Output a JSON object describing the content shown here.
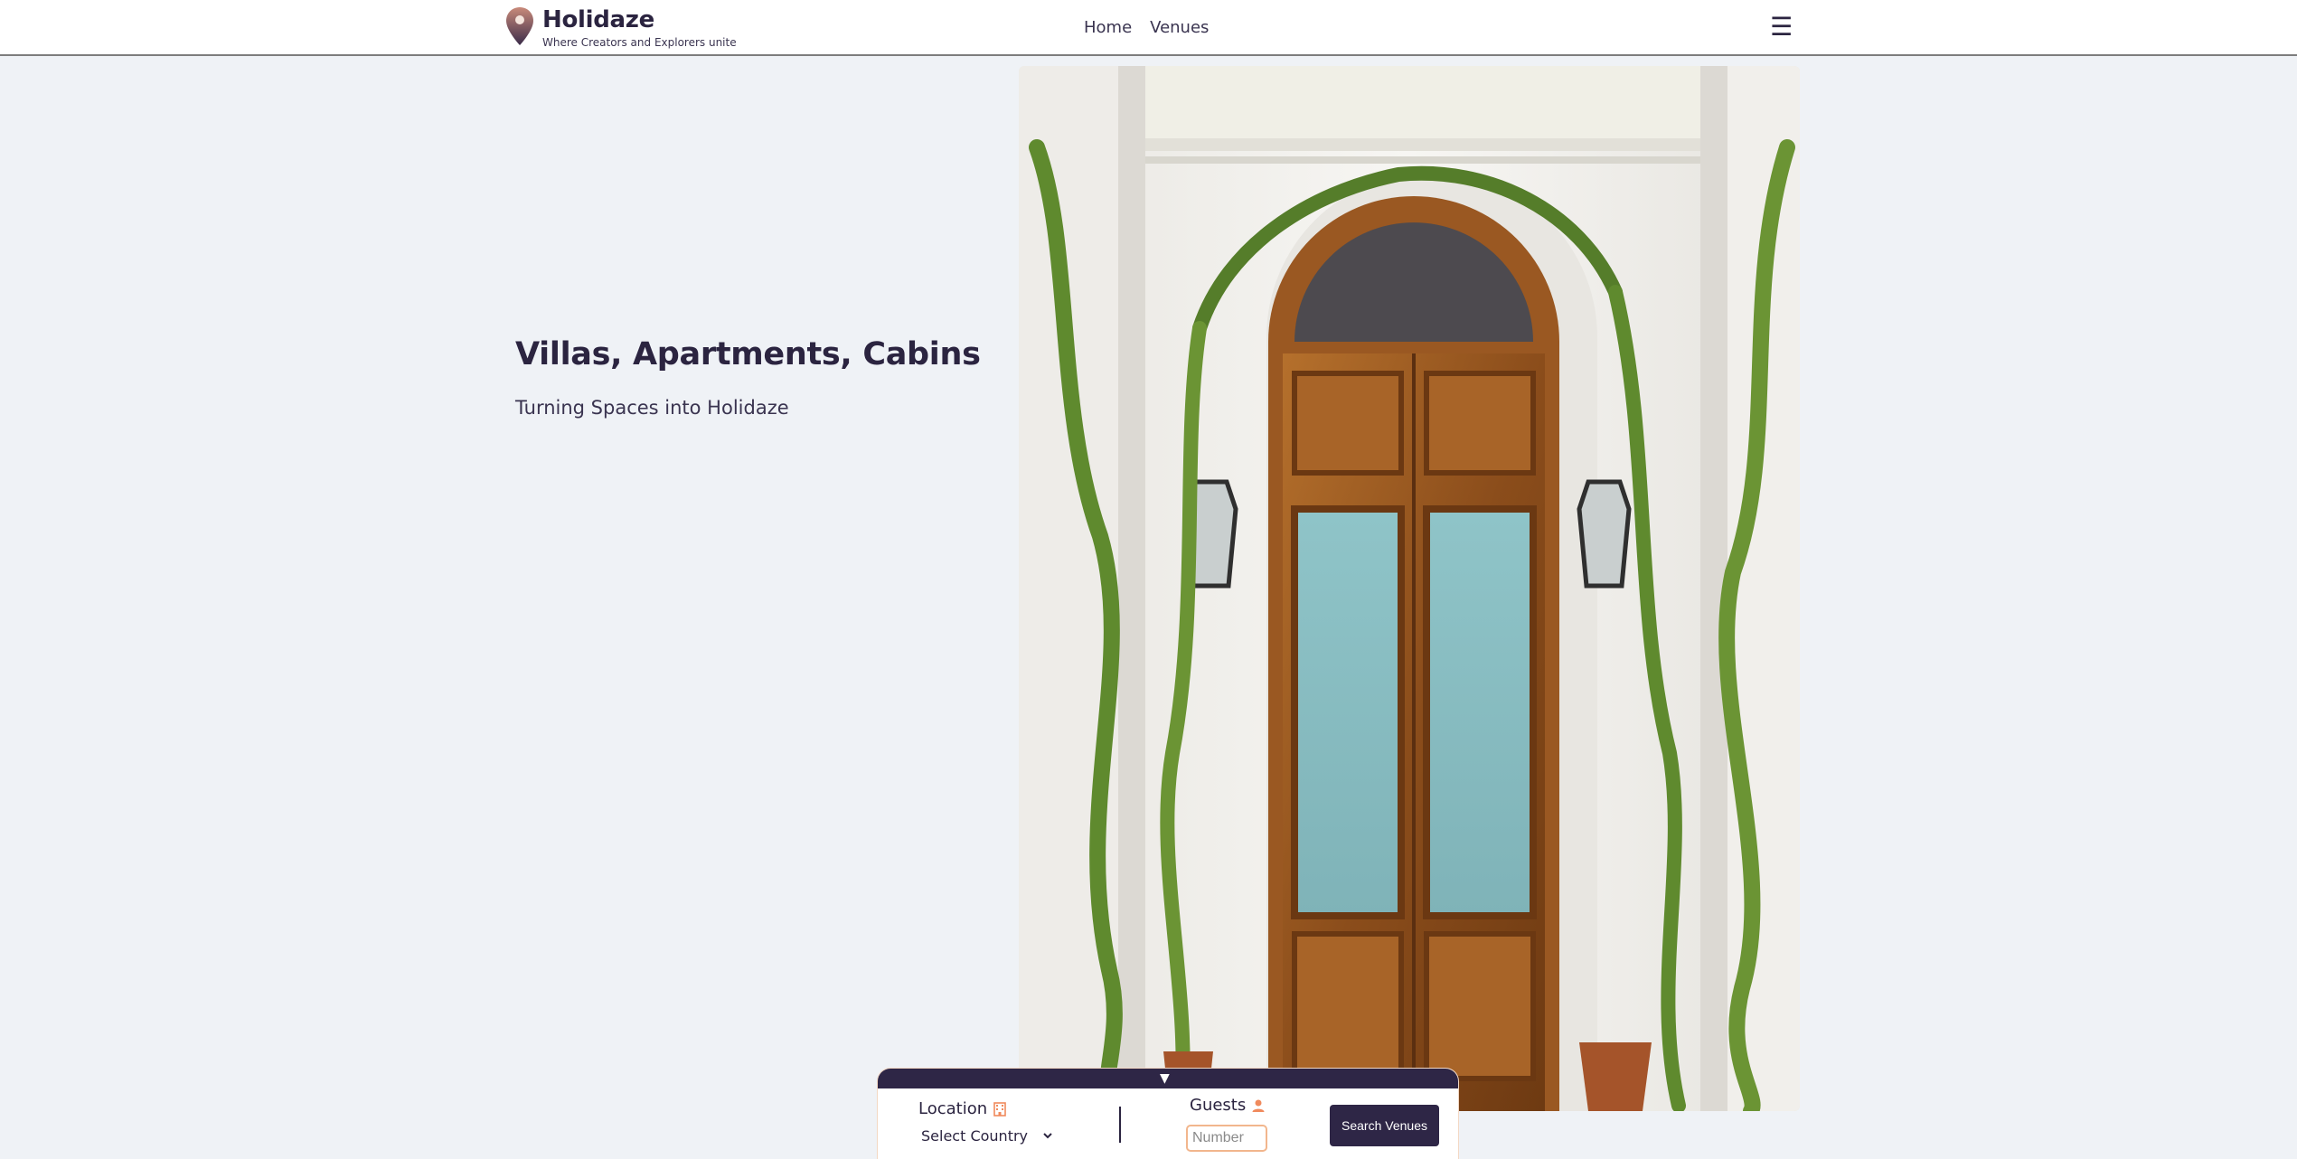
{
  "header": {
    "brand_name": "Holidaze",
    "tagline": "Where Creators and Explorers unite",
    "nav": [
      {
        "label": "Home"
      },
      {
        "label": "Venues"
      }
    ],
    "menu_icon": "☰"
  },
  "hero": {
    "title": "Villas, Apartments, Cabins",
    "subtitle": "Turning Spaces into Holidaze"
  },
  "search": {
    "location_label": "Location",
    "location_icon": "hotel-icon",
    "location_select_value": "Select Country",
    "guests_label": "Guests",
    "guests_icon": "user-icon",
    "guests_placeholder": "Number",
    "button_label": "Search Venues"
  },
  "colors": {
    "primary": "#2e2646",
    "accent": "#f08a5d",
    "background": "#eff2f6"
  }
}
